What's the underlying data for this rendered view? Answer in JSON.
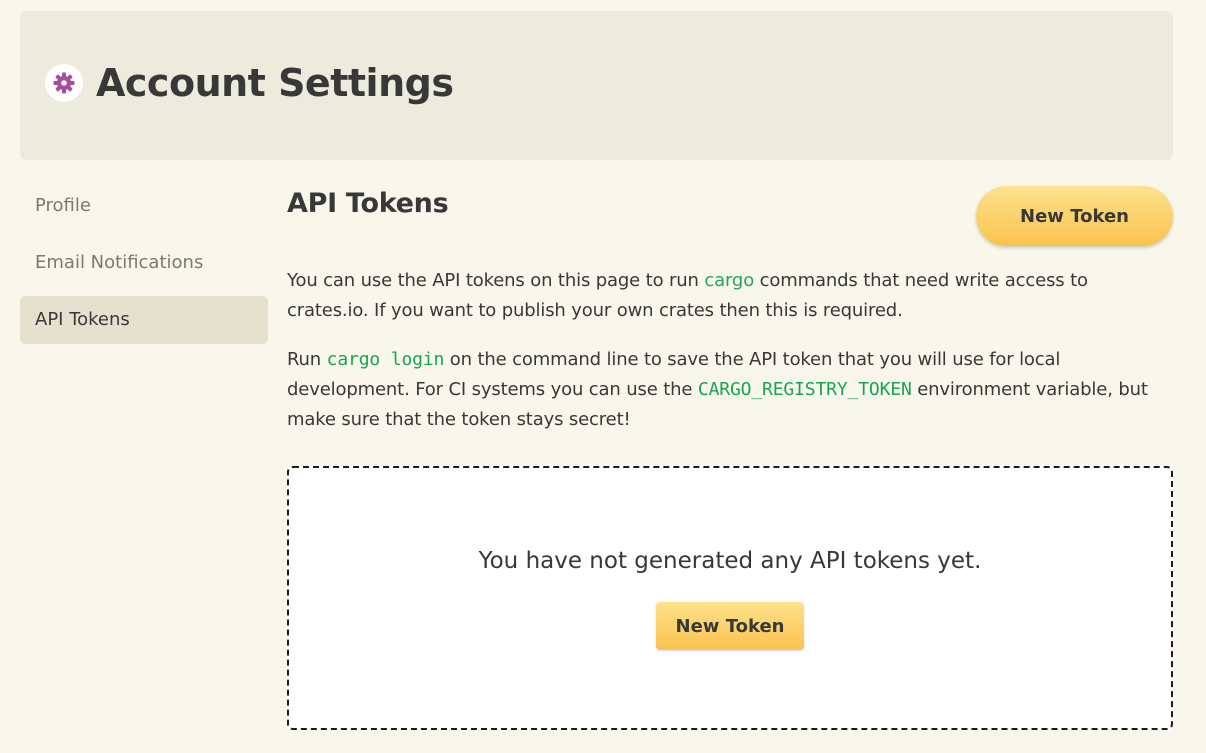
{
  "header": {
    "title": "Account Settings",
    "icon": "gear-icon",
    "icon_color": "#a74c9a"
  },
  "sidebar": {
    "items": [
      {
        "label": "Profile",
        "active": false
      },
      {
        "label": "Email Notifications",
        "active": false
      },
      {
        "label": "API Tokens",
        "active": true
      }
    ]
  },
  "main": {
    "title": "API Tokens",
    "new_token_label": "New Token",
    "para1": {
      "before": "You can use the API tokens on this page to run ",
      "code": "cargo",
      "after": " commands that need write access to crates.io. If you want to publish your own crates then this is required."
    },
    "para2": {
      "before": "Run ",
      "code1": "cargo login",
      "middle": " on the command line to save the API token that you will use for local development. For CI systems you can use the ",
      "code2": "CARGO_REGISTRY_TOKEN",
      "after": " environment variable, but make sure that the token stays secret!"
    },
    "empty_state": {
      "message": "You have not generated any API tokens yet.",
      "button_label": "New Token"
    }
  },
  "colors": {
    "background": "#f9f7ec",
    "header_bg": "#edebdd",
    "sidebar_active_bg": "#e6e1cf",
    "button_yellow": "#fcd26a",
    "code_green": "#23a561",
    "text": "#383838",
    "muted_text": "#7a7a72"
  }
}
